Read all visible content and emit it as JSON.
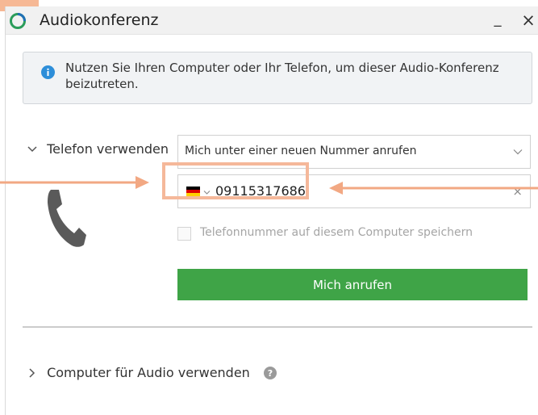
{
  "window": {
    "title": "Audiokonferenz",
    "minimize_label": "_",
    "close_label": "×"
  },
  "info": {
    "text": "Nutzen Sie Ihren Computer oder Ihr Telefon, um dieser Audio-Konferenz beizutreten."
  },
  "phone_section": {
    "toggle_label": "Telefon verwenden",
    "mode_select_value": "Mich unter einer neuen Nummer anrufen",
    "country_flag": "germany-flag",
    "phone_number": "09115317686",
    "clear_label": "×",
    "save_checkbox_label": "Telefonnummer auf diesem Computer speichern",
    "save_checkbox_checked": false,
    "call_button_label": "Mich anrufen"
  },
  "computer_section": {
    "toggle_label": "Computer für Audio verwenden"
  },
  "icons": {
    "app": "app-logo-icon",
    "info": "info-icon",
    "phone": "phone-handset-icon",
    "help": "help-icon"
  },
  "colors": {
    "accent_green": "#3fa447",
    "info_blue": "#2d8ed9",
    "highlight_orange": "#f5b89a",
    "arrow_orange": "#f2a883"
  }
}
